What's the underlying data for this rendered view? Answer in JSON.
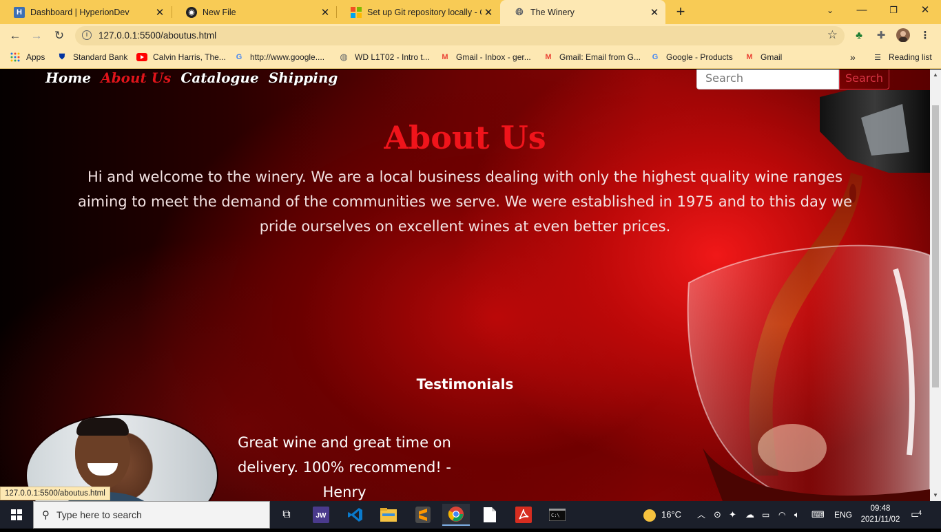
{
  "browser": {
    "tabs": [
      {
        "title": "Dashboard | HyperionDev",
        "icon": "hyperiondev-icon",
        "active": false
      },
      {
        "title": "New File",
        "icon": "github-icon",
        "active": false
      },
      {
        "title": "Set up Git repository locally - Cor",
        "icon": "microsoft-icon",
        "active": false
      },
      {
        "title": "The Winery",
        "icon": "globe-icon",
        "active": true
      }
    ],
    "new_tab": "+",
    "url": "127.0.0.1:5500/aboutus.html",
    "bookmarks": [
      {
        "label": "Apps",
        "icon": "apps-grid-icon"
      },
      {
        "label": "Standard Bank",
        "icon": "standard-bank-icon"
      },
      {
        "label": "Calvin Harris, The...",
        "icon": "youtube-icon"
      },
      {
        "label": "http://www.google....",
        "icon": "google-icon"
      },
      {
        "label": "WD L1T02 - Intro t...",
        "icon": "globe-icon"
      },
      {
        "label": "Gmail - Inbox - ger...",
        "icon": "gmail-icon"
      },
      {
        "label": "Gmail: Email from G...",
        "icon": "gmail-icon"
      },
      {
        "label": "Google - Products",
        "icon": "google-icon"
      },
      {
        "label": "Gmail",
        "icon": "gmail-icon"
      }
    ],
    "reading_list": "Reading list",
    "status_url": "127.0.0.1:5500/aboutus.html"
  },
  "site": {
    "nav": [
      "Home",
      "About Us",
      "Catalogue",
      "Shipping"
    ],
    "current_nav": "About Us",
    "search": {
      "placeholder": "Search",
      "button": "Search"
    },
    "heading": "About Us",
    "intro": "Hi and welcome to the winery. We are a local business dealing with only the highest quality wine ranges aiming to meet the demand of the communities we serve. We were established in 1975 and to this day we pride ourselves on excellent wines at even better prices.",
    "testimonials_title": "Testimonials",
    "testimonial": "Great wine and great time on delivery. 100% recommend! - Henry",
    "colors": {
      "accent": "#e0141a",
      "button": "#dc3545"
    }
  },
  "taskbar": {
    "search_placeholder": "Type here to search",
    "weather": "16°C",
    "language": "ENG",
    "time": "09:48",
    "date": "2021/11/02",
    "notifications": "4"
  }
}
